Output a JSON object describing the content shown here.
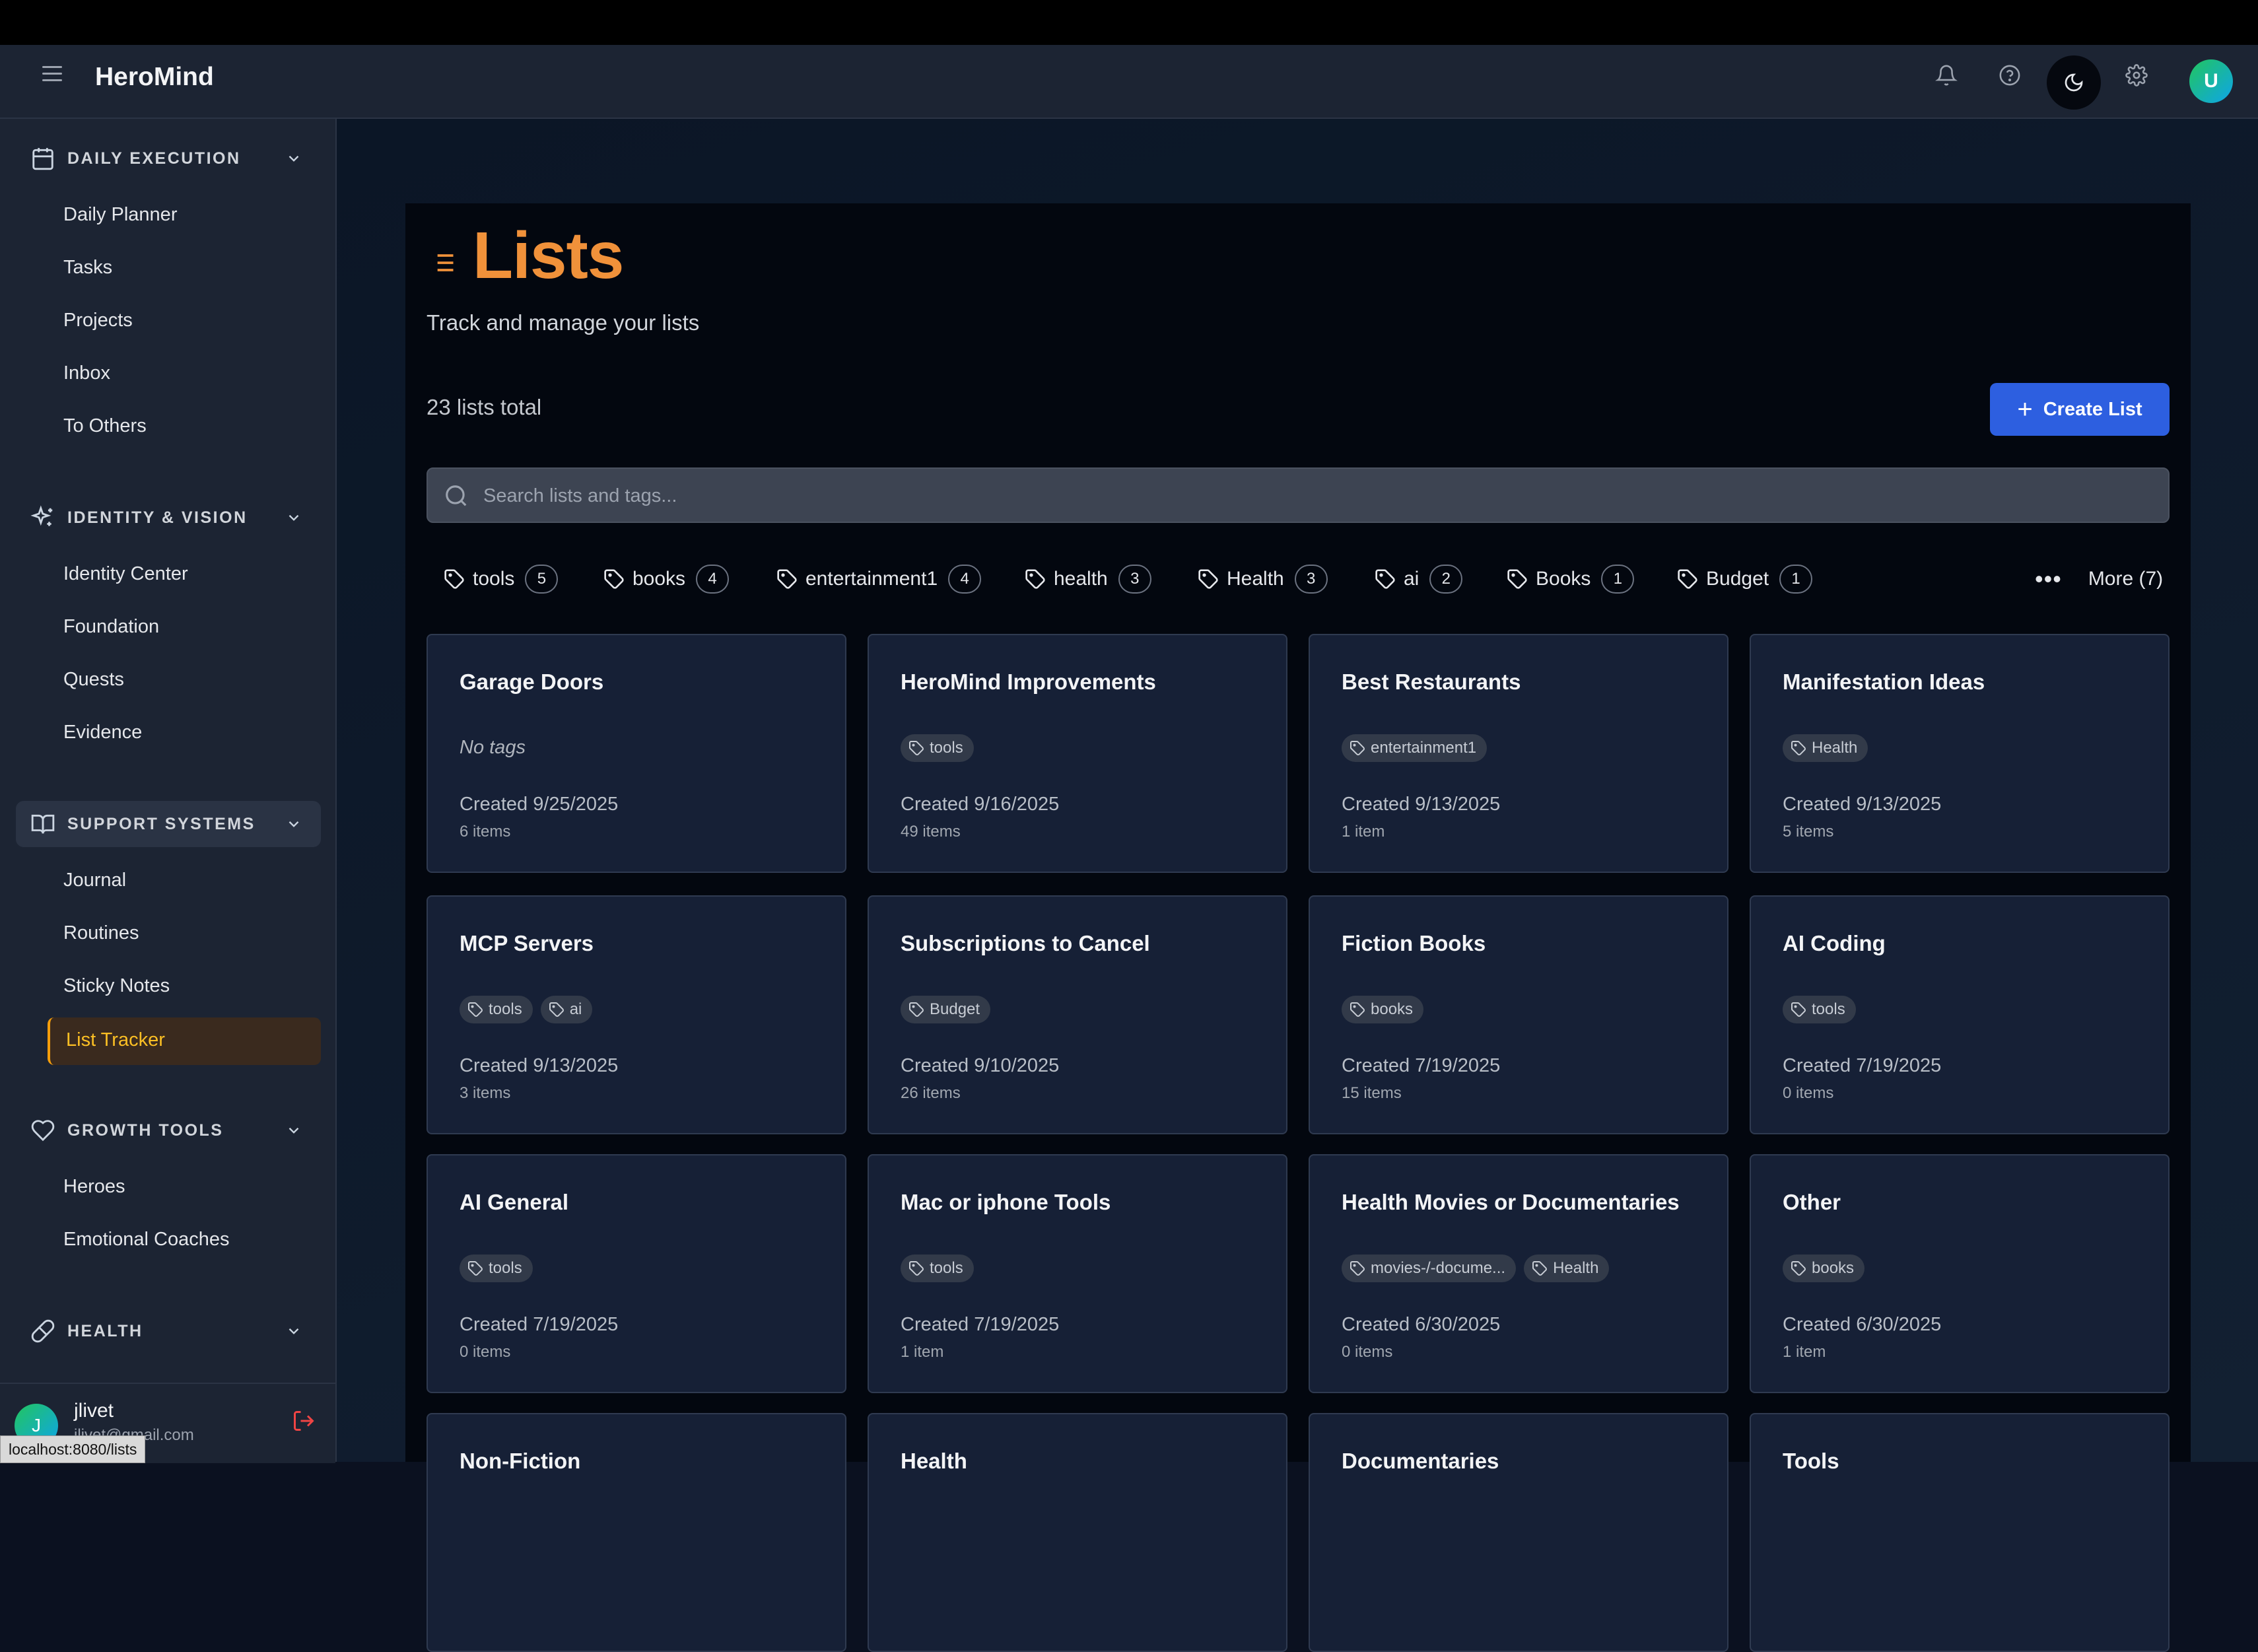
{
  "app": {
    "name": "HeroMind"
  },
  "header": {
    "icons": [
      "bell-icon",
      "help-circle-icon",
      "moon-icon",
      "gear-icon"
    ],
    "user_initial": "U"
  },
  "sidebar": {
    "sections": [
      {
        "title": "DAILY EXECUTION",
        "icon": "calendar-icon",
        "items": [
          "Daily Planner",
          "Tasks",
          "Projects",
          "Inbox",
          "To Others"
        ]
      },
      {
        "title": "IDENTITY & VISION",
        "icon": "sparkles-icon",
        "items": [
          "Identity Center",
          "Foundation",
          "Quests",
          "Evidence"
        ]
      },
      {
        "title": "SUPPORT SYSTEMS",
        "icon": "book-open-icon",
        "items": [
          "Journal",
          "Routines",
          "Sticky Notes",
          "List Tracker"
        ]
      },
      {
        "title": "GROWTH TOOLS",
        "icon": "heart-icon",
        "items": [
          "Heroes",
          "Emotional Coaches"
        ]
      },
      {
        "title": "HEALTH",
        "icon": "pill-icon",
        "items": []
      }
    ],
    "active_item": "List Tracker",
    "user": {
      "initial": "J",
      "name": "jlivet",
      "email": "jlivet@gmail.com"
    }
  },
  "status_url": "localhost:8080/lists",
  "page": {
    "title": "Lists",
    "subtitle": "Track and manage your lists",
    "total": "23 lists total",
    "create_label": "Create List",
    "search_placeholder": "Search lists and tags..."
  },
  "tag_filters": [
    {
      "name": "tools",
      "count": "5"
    },
    {
      "name": "books",
      "count": "4"
    },
    {
      "name": "entertainment1",
      "count": "4"
    },
    {
      "name": "health",
      "count": "3"
    },
    {
      "name": "Health",
      "count": "3"
    },
    {
      "name": "ai",
      "count": "2"
    },
    {
      "name": "Books",
      "count": "1"
    },
    {
      "name": "Budget",
      "count": "1"
    }
  ],
  "more_label": "More (7)",
  "no_tags_label": "No tags",
  "cards": [
    {
      "title": "Garage Doors",
      "tags": [],
      "created": "Created 9/25/2025",
      "items": "6 items"
    },
    {
      "title": "HeroMind Improvements",
      "tags": [
        "tools"
      ],
      "created": "Created 9/16/2025",
      "items": "49 items"
    },
    {
      "title": "Best Restaurants",
      "tags": [
        "entertainment1"
      ],
      "created": "Created 9/13/2025",
      "items": "1 item"
    },
    {
      "title": "Manifestation Ideas",
      "tags": [
        "Health"
      ],
      "created": "Created 9/13/2025",
      "items": "5 items"
    },
    {
      "title": "MCP Servers",
      "tags": [
        "tools",
        "ai"
      ],
      "created": "Created 9/13/2025",
      "items": "3 items"
    },
    {
      "title": "Subscriptions to Cancel",
      "tags": [
        "Budget"
      ],
      "created": "Created 9/10/2025",
      "items": "26 items"
    },
    {
      "title": "Fiction Books",
      "tags": [
        "books"
      ],
      "created": "Created 7/19/2025",
      "items": "15 items"
    },
    {
      "title": "AI Coding",
      "tags": [
        "tools"
      ],
      "created": "Created 7/19/2025",
      "items": "0 items"
    },
    {
      "title": "AI General",
      "tags": [
        "tools"
      ],
      "created": "Created 7/19/2025",
      "items": "0 items"
    },
    {
      "title": "Mac or iphone Tools",
      "tags": [
        "tools"
      ],
      "created": "Created 7/19/2025",
      "items": "1 item"
    },
    {
      "title": "Health Movies or Documentaries",
      "tags": [
        "movies-/-docume...",
        "Health"
      ],
      "created": "Created 6/30/2025",
      "items": "0 items"
    },
    {
      "title": "Other",
      "tags": [
        "books"
      ],
      "created": "Created 6/30/2025",
      "items": "1 item"
    },
    {
      "title": "Non-Fiction",
      "tags": [],
      "created": "",
      "items": ""
    },
    {
      "title": "Health",
      "tags": [],
      "created": "",
      "items": ""
    },
    {
      "title": "Documentaries",
      "tags": [],
      "created": "",
      "items": ""
    },
    {
      "title": "Tools",
      "tags": [],
      "created": "",
      "items": ""
    }
  ],
  "colors": {
    "accent": "#f0913a",
    "primary_button": "#2d5fe0",
    "active_nav": "#fbbf24"
  }
}
